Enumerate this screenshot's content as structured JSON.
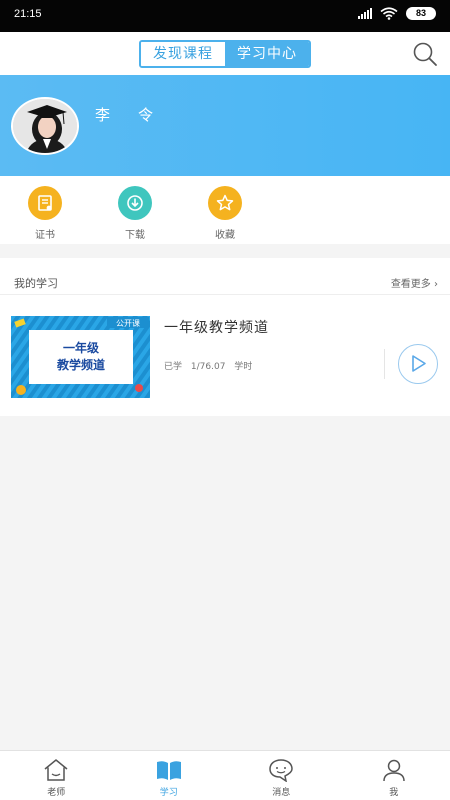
{
  "status_bar": {
    "time": "21:15",
    "battery": "83"
  },
  "header": {
    "tabs": [
      {
        "label": "发现课程",
        "active": false
      },
      {
        "label": "学习中心",
        "active": true
      }
    ],
    "search_icon": "search-icon",
    "accent_color": "#4cb1ec"
  },
  "profile": {
    "name": "李令"
  },
  "quick_actions": [
    {
      "label": "证书",
      "icon": "certificate-icon",
      "color": "#f5b21f"
    },
    {
      "label": "下载",
      "icon": "download-icon",
      "color": "#3fc6be"
    },
    {
      "label": "收藏",
      "icon": "star-icon",
      "color": "#f5b21f"
    }
  ],
  "my_study": {
    "title": "我的学习",
    "more_label": "查看更多",
    "course": {
      "thumb_badge": "公开课",
      "thumb_line1": "一年级",
      "thumb_line2": "教学频道",
      "title": "一年级教学频道",
      "progress_prefix": "已学",
      "progress_value": "1/76.07",
      "progress_unit": "学时"
    }
  },
  "bottom_nav": [
    {
      "label": "老师",
      "icon": "home-icon",
      "active": false
    },
    {
      "label": "学习",
      "icon": "book-icon",
      "active": true
    },
    {
      "label": "消息",
      "icon": "chat-icon",
      "active": false
    },
    {
      "label": "我",
      "icon": "person-icon",
      "active": false
    }
  ]
}
